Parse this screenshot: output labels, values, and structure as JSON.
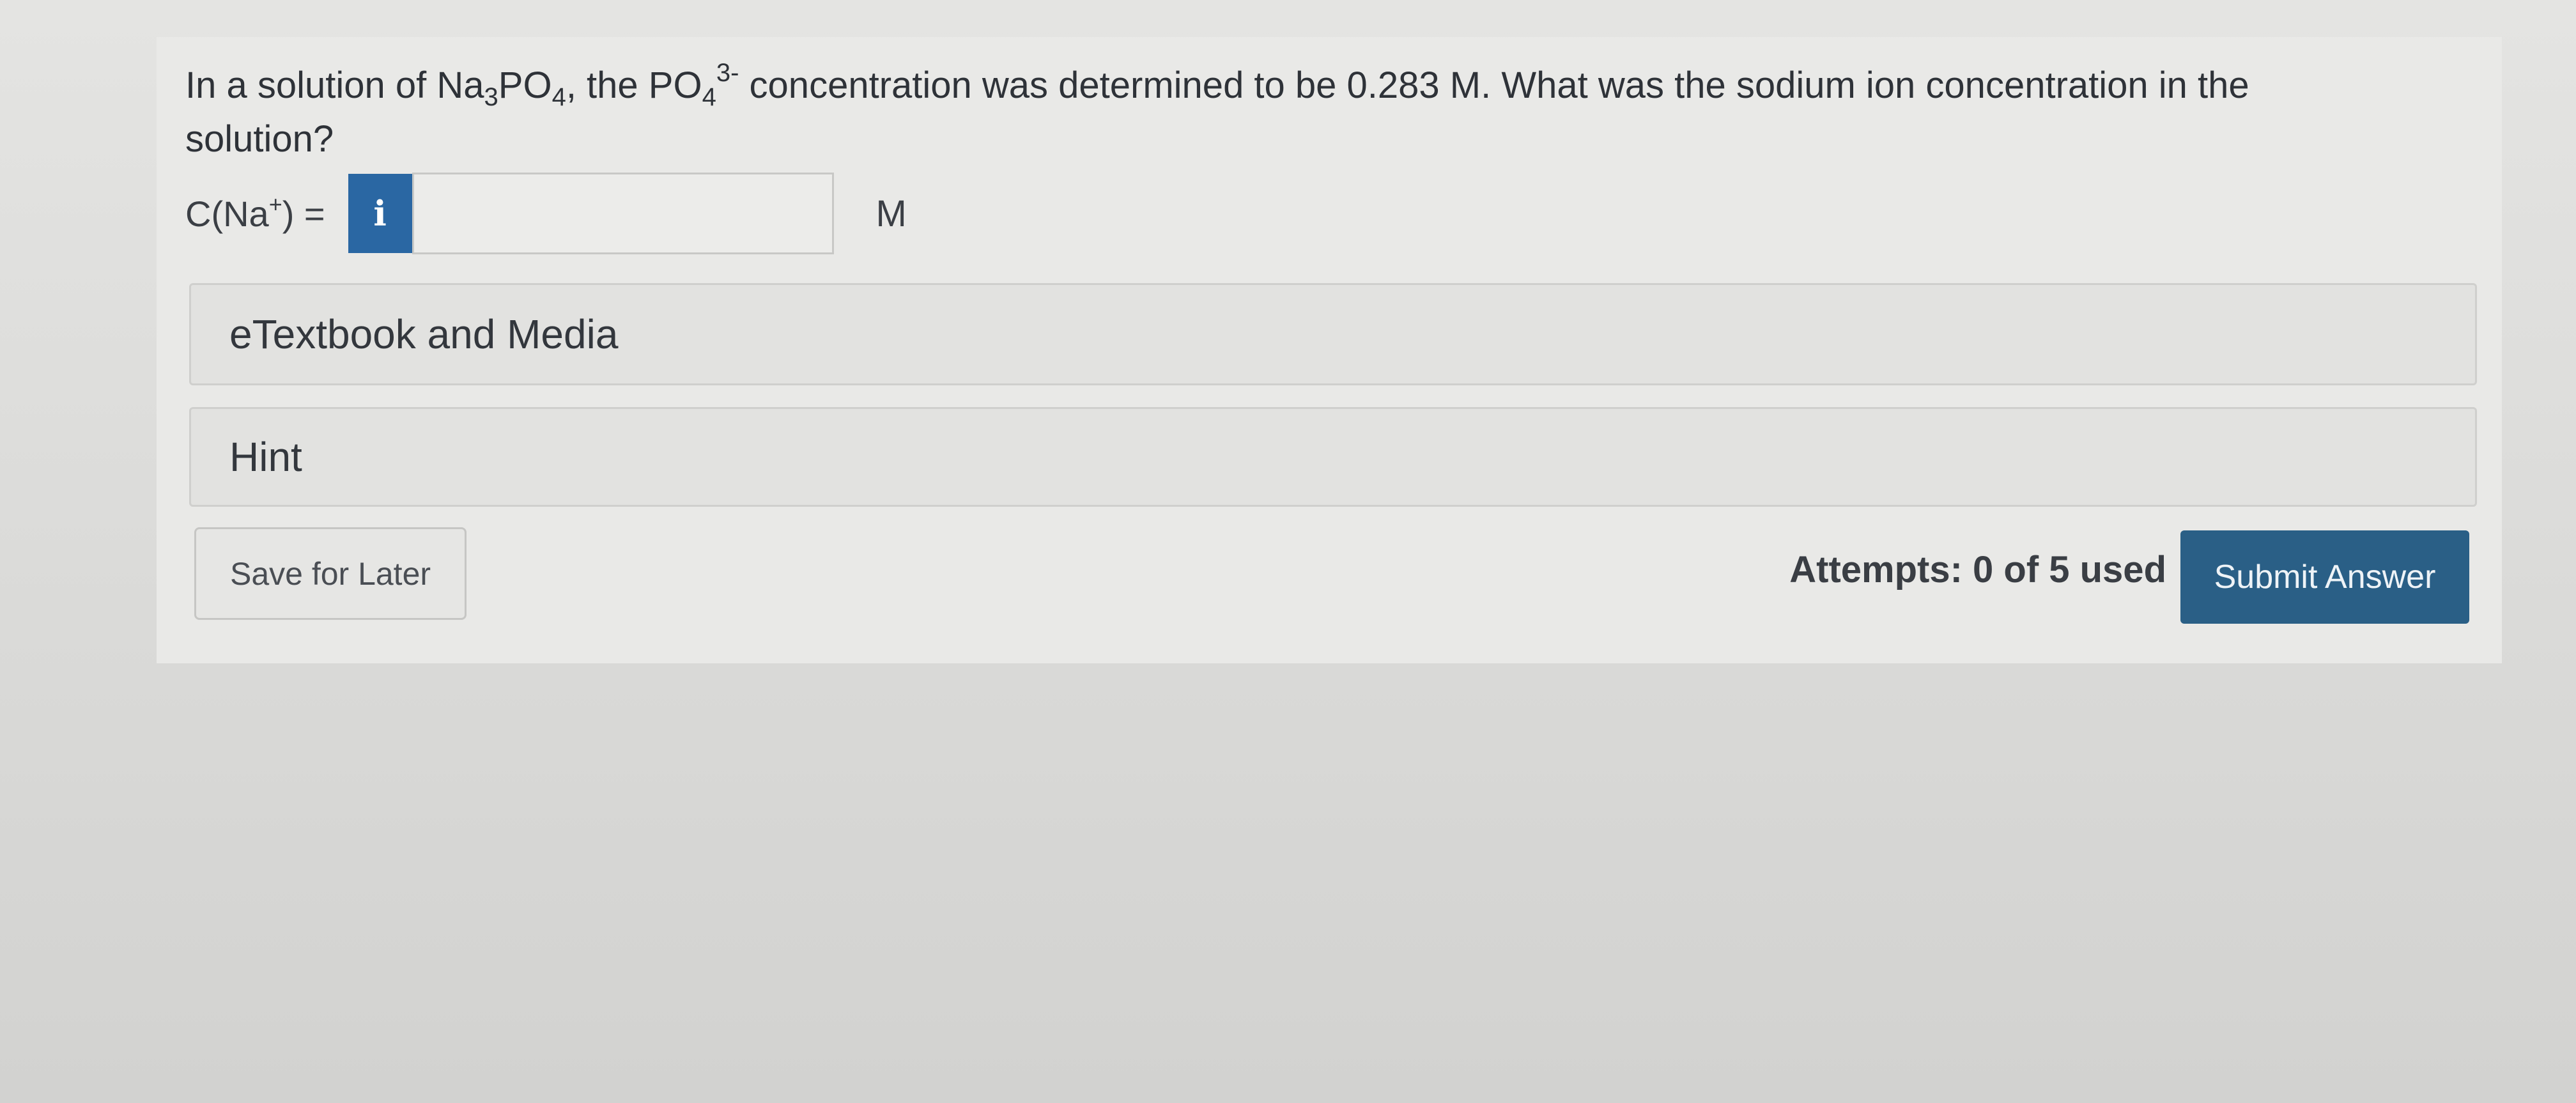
{
  "question": {
    "p1": "In a solution of Na",
    "s1": "3",
    "p2": "PO",
    "s2": "4",
    "p3": ", the PO",
    "s3": "4",
    "sup3": "3-",
    "p4": " concentration was determined to be 0.283 M. What was the sodium ion concentration in the solution?"
  },
  "answer": {
    "label_prefix": "C(Na",
    "label_charge": "+",
    "label_suffix": ") =",
    "info_icon": "i",
    "value": "",
    "unit": "M"
  },
  "sections": {
    "etextbook": "eTextbook and Media",
    "hint": "Hint"
  },
  "footer": {
    "save_label": "Save for Later",
    "attempts": "Attempts: 0 of 5 used",
    "submit_label": "Submit Answer"
  },
  "colors": {
    "accent": "#2a67a3",
    "submit": "#2a5f86"
  }
}
